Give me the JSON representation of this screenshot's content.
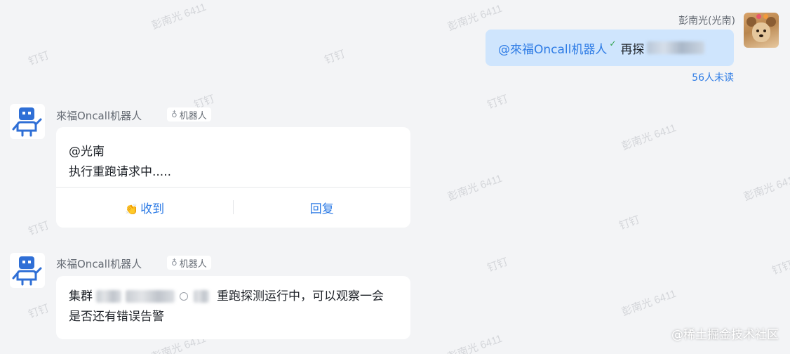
{
  "watermark": {
    "name_text": "彭南光 6411",
    "brand_text": "钉钉"
  },
  "outgoing": {
    "sender": "彭南光(光南)",
    "mention": "@來福Oncall机器人",
    "text": "再探",
    "read_status": "56人未读"
  },
  "messages": [
    {
      "bot_name": "來福Oncall机器人",
      "tag": "机器人",
      "lines": [
        "@光南",
        "执行重跑请求中....."
      ],
      "actions": [
        "收到",
        "回复"
      ]
    },
    {
      "bot_name": "來福Oncall机器人",
      "tag": "机器人",
      "line1_prefix": "集群",
      "line1_suffix": "重跑探测运行中，可以观察一会",
      "line2": "是否还有错误告警"
    }
  ],
  "footer": "@稀土掘金技术社区",
  "colors": {
    "background": "#f3f4f6",
    "outgoing_bubble": "#cfe5fd",
    "link_blue": "#2d7be5",
    "bot_blue": "#2f6fd6"
  }
}
